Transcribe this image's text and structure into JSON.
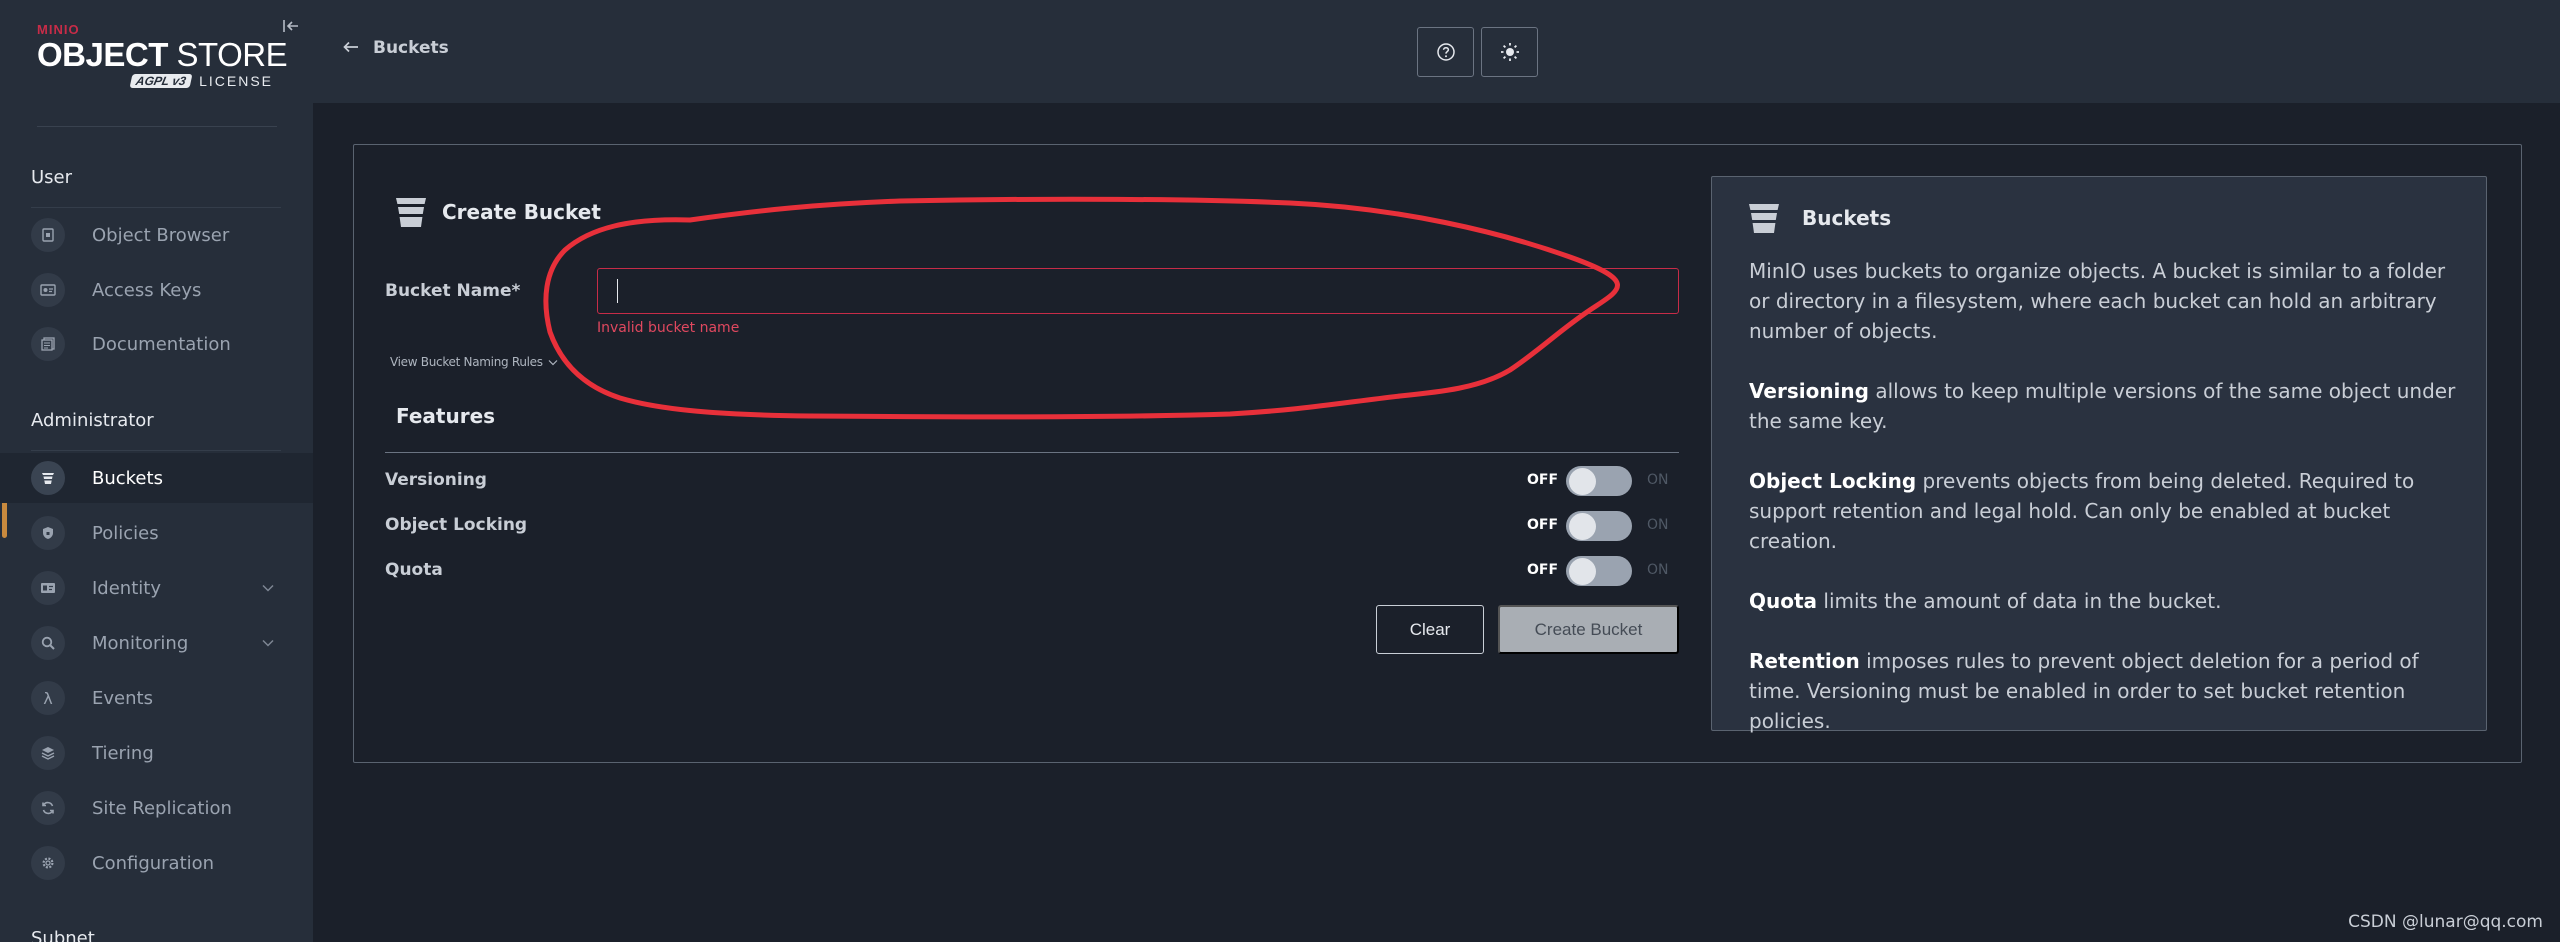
{
  "brand": {
    "small": "MINIO",
    "object": "OBJECT",
    "store": "STORE",
    "agpl": "AGPL v3",
    "license": "LICENSE"
  },
  "sidebar": {
    "user_section": "User",
    "user_items": [
      {
        "label": "Object Browser",
        "icon": "object-browser-icon"
      },
      {
        "label": "Access Keys",
        "icon": "access-keys-icon"
      },
      {
        "label": "Documentation",
        "icon": "documentation-icon"
      }
    ],
    "admin_section": "Administrator",
    "admin_items": [
      {
        "label": "Buckets",
        "icon": "bucket-icon",
        "active": true
      },
      {
        "label": "Policies",
        "icon": "shield-icon"
      },
      {
        "label": "Identity",
        "icon": "id-card-icon",
        "expandable": true
      },
      {
        "label": "Monitoring",
        "icon": "magnifier-icon",
        "expandable": true
      },
      {
        "label": "Events",
        "icon": "lambda-icon"
      },
      {
        "label": "Tiering",
        "icon": "layers-icon"
      },
      {
        "label": "Site Replication",
        "icon": "replication-icon"
      },
      {
        "label": "Configuration",
        "icon": "gear-icon"
      }
    ],
    "next_section": "Subnet"
  },
  "header": {
    "back_label": "Buckets"
  },
  "form": {
    "title": "Create Bucket",
    "bucket_name_label": "Bucket Name*",
    "bucket_name_value": "",
    "error": "Invalid bucket name",
    "naming_rules_link": "View Bucket Naming Rules",
    "features_title": "Features",
    "features": [
      {
        "label": "Versioning",
        "off": "OFF",
        "on": "ON",
        "enabled": false
      },
      {
        "label": "Object Locking",
        "off": "OFF",
        "on": "ON",
        "enabled": false
      },
      {
        "label": "Quota",
        "off": "OFF",
        "on": "ON",
        "enabled": false
      }
    ],
    "clear_label": "Clear",
    "create_label": "Create Bucket"
  },
  "help": {
    "title": "Buckets",
    "intro": "MinIO uses buckets to organize objects. A bucket is similar to a folder or directory in a filesystem, where each bucket can hold an arbitrary number of objects.",
    "versioning_term": "Versioning",
    "versioning_text": " allows to keep multiple versions of the same object under the same key.",
    "locking_term": "Object Locking",
    "locking_text": " prevents objects from being deleted. Required to support retention and legal hold. Can only be enabled at bucket creation.",
    "quota_term": "Quota",
    "quota_text": " limits the amount of data in the bucket.",
    "retention_term": "Retention",
    "retention_text": " imposes rules to prevent object deletion for a period of time. Versioning must be enabled in order to set bucket retention policies."
  },
  "annotation_color": "#e8303a",
  "watermark": "CSDN @lunar@qq.com"
}
